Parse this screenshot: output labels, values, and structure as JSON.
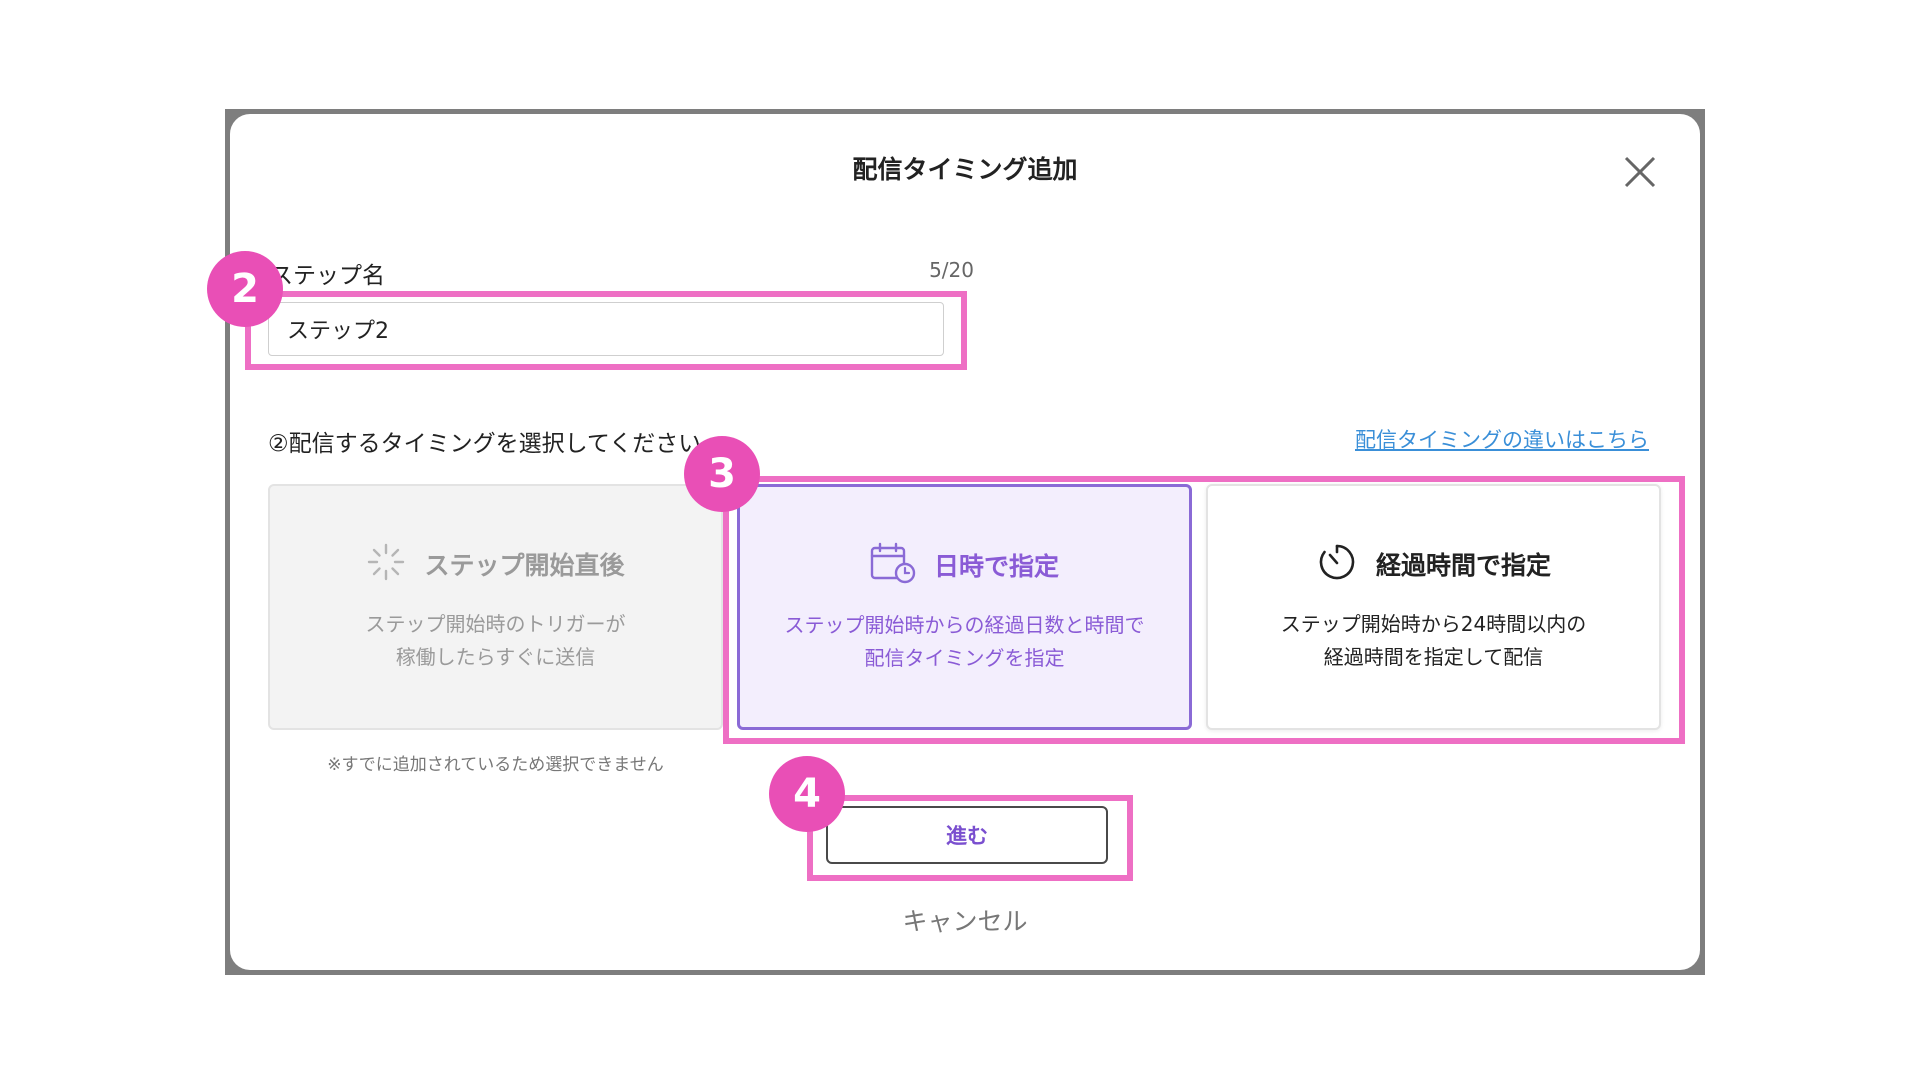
{
  "dialog": {
    "title": "配信タイミング追加",
    "close_icon": "close-icon"
  },
  "step_name": {
    "label": "ステップ名",
    "counter": "5/20",
    "value": "ステップ2"
  },
  "timing": {
    "question": "②配信するタイミングを選択してください",
    "help_link": "配信タイミングの違いはこちら",
    "options": [
      {
        "icon": "spinner-icon",
        "title": "ステップ開始直後",
        "desc_line1": "ステップ開始時のトリガーが",
        "desc_line2": "稼働したらすぐに送信",
        "state": "disabled"
      },
      {
        "icon": "calendar-clock-icon",
        "title": "日時で指定",
        "desc_line1": "ステップ開始時からの経過日数と時間で",
        "desc_line2": "配信タイミングを指定",
        "state": "selected"
      },
      {
        "icon": "timer-icon",
        "title": "経過時間で指定",
        "desc_line1": "ステップ開始時から24時間以内の",
        "desc_line2": "経過時間を指定して配信",
        "state": "normal"
      }
    ],
    "disabled_note": "※すでに追加されているため選択できません"
  },
  "actions": {
    "next_label": "進む",
    "cancel_label": "キャンセル"
  },
  "annotations": {
    "badges": [
      "2",
      "3",
      "4"
    ],
    "highlight_color": "#ee6fc4",
    "badge_color": "#e94fb6"
  },
  "colors": {
    "accent": "#8a5bd6",
    "link": "#3a8fd8"
  }
}
